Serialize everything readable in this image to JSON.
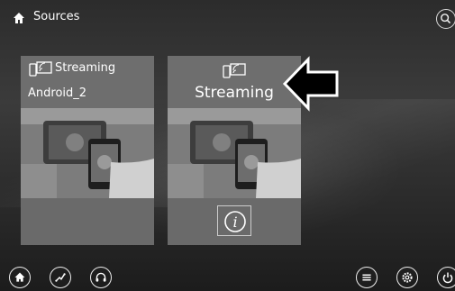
{
  "header": {
    "title": "Sources",
    "home_icon": "home-icon",
    "search_icon": "search-icon"
  },
  "cards": [
    {
      "label": "Streaming",
      "device": "Android_2",
      "icon": "phone-cast-icon"
    },
    {
      "label": "Streaming",
      "icon": "phone-cast-icon",
      "info_icon": "info-icon"
    }
  ],
  "bottom_nav": {
    "left": [
      "home-icon",
      "apps-icon",
      "headphones-icon"
    ],
    "right": [
      "menu-icon",
      "gear-icon",
      "power-icon"
    ]
  },
  "colors": {
    "text": "#ffffff",
    "card": "#6a6a6a",
    "arrow": "#000000"
  }
}
